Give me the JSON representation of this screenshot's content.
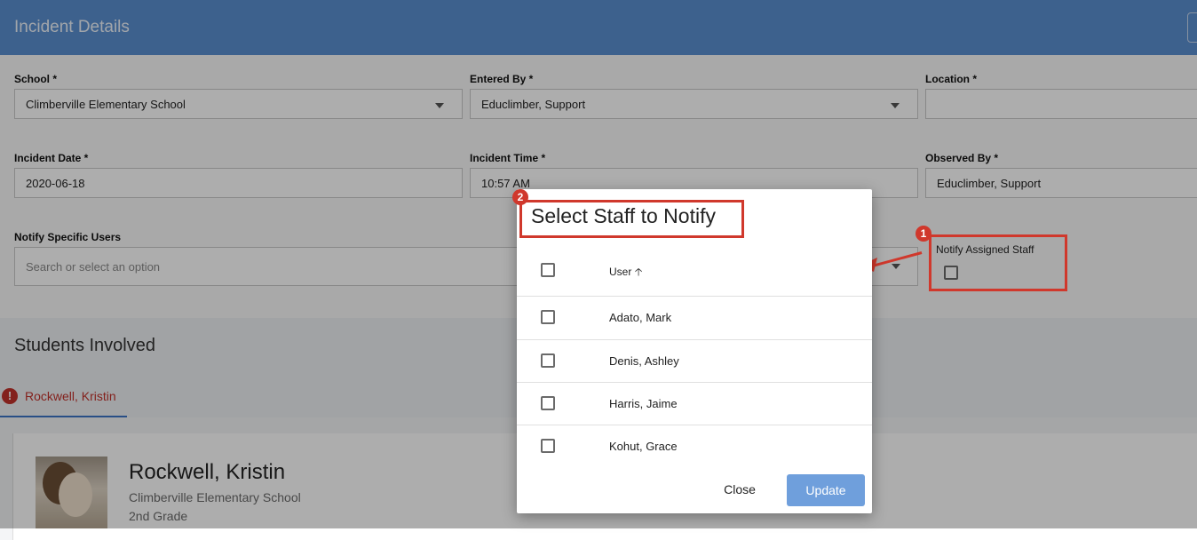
{
  "header": {
    "title": "Incident Details"
  },
  "form": {
    "school": {
      "label": "School *",
      "value": "Climberville Elementary School"
    },
    "entered_by": {
      "label": "Entered By *",
      "value": "Educlimber, Support"
    },
    "location": {
      "label": "Location *",
      "value": ""
    },
    "incident_date": {
      "label": "Incident Date *",
      "value": "2020-06-18"
    },
    "incident_time": {
      "label": "Incident Time *",
      "value": "10:57 AM"
    },
    "observed_by": {
      "label": "Observed By *",
      "value": "Educlimber, Support"
    },
    "notify_users": {
      "label": "Notify Specific Users",
      "placeholder": "Search or select an option"
    },
    "notify_assigned": {
      "label": "Notify Assigned Staff",
      "checked": false
    }
  },
  "students": {
    "title": "Students Involved",
    "tab_label": "Rockwell, Kristin",
    "tab_icon": "!",
    "card": {
      "name": "Rockwell, Kristin",
      "school": "Climberville Elementary School",
      "grade": "2nd Grade"
    }
  },
  "dialog": {
    "title": "Select Staff to Notify",
    "column_header": "User",
    "sort_glyph": "🡡",
    "rows": [
      {
        "name": "Adato, Mark",
        "checked": false
      },
      {
        "name": "Denis, Ashley",
        "checked": false
      },
      {
        "name": "Harris, Jaime",
        "checked": false
      },
      {
        "name": "Kohut, Grace",
        "checked": false
      }
    ],
    "close_label": "Close",
    "update_label": "Update"
  },
  "annotations": {
    "badge_1": "1",
    "badge_2": "2",
    "color": "#d0382c"
  }
}
